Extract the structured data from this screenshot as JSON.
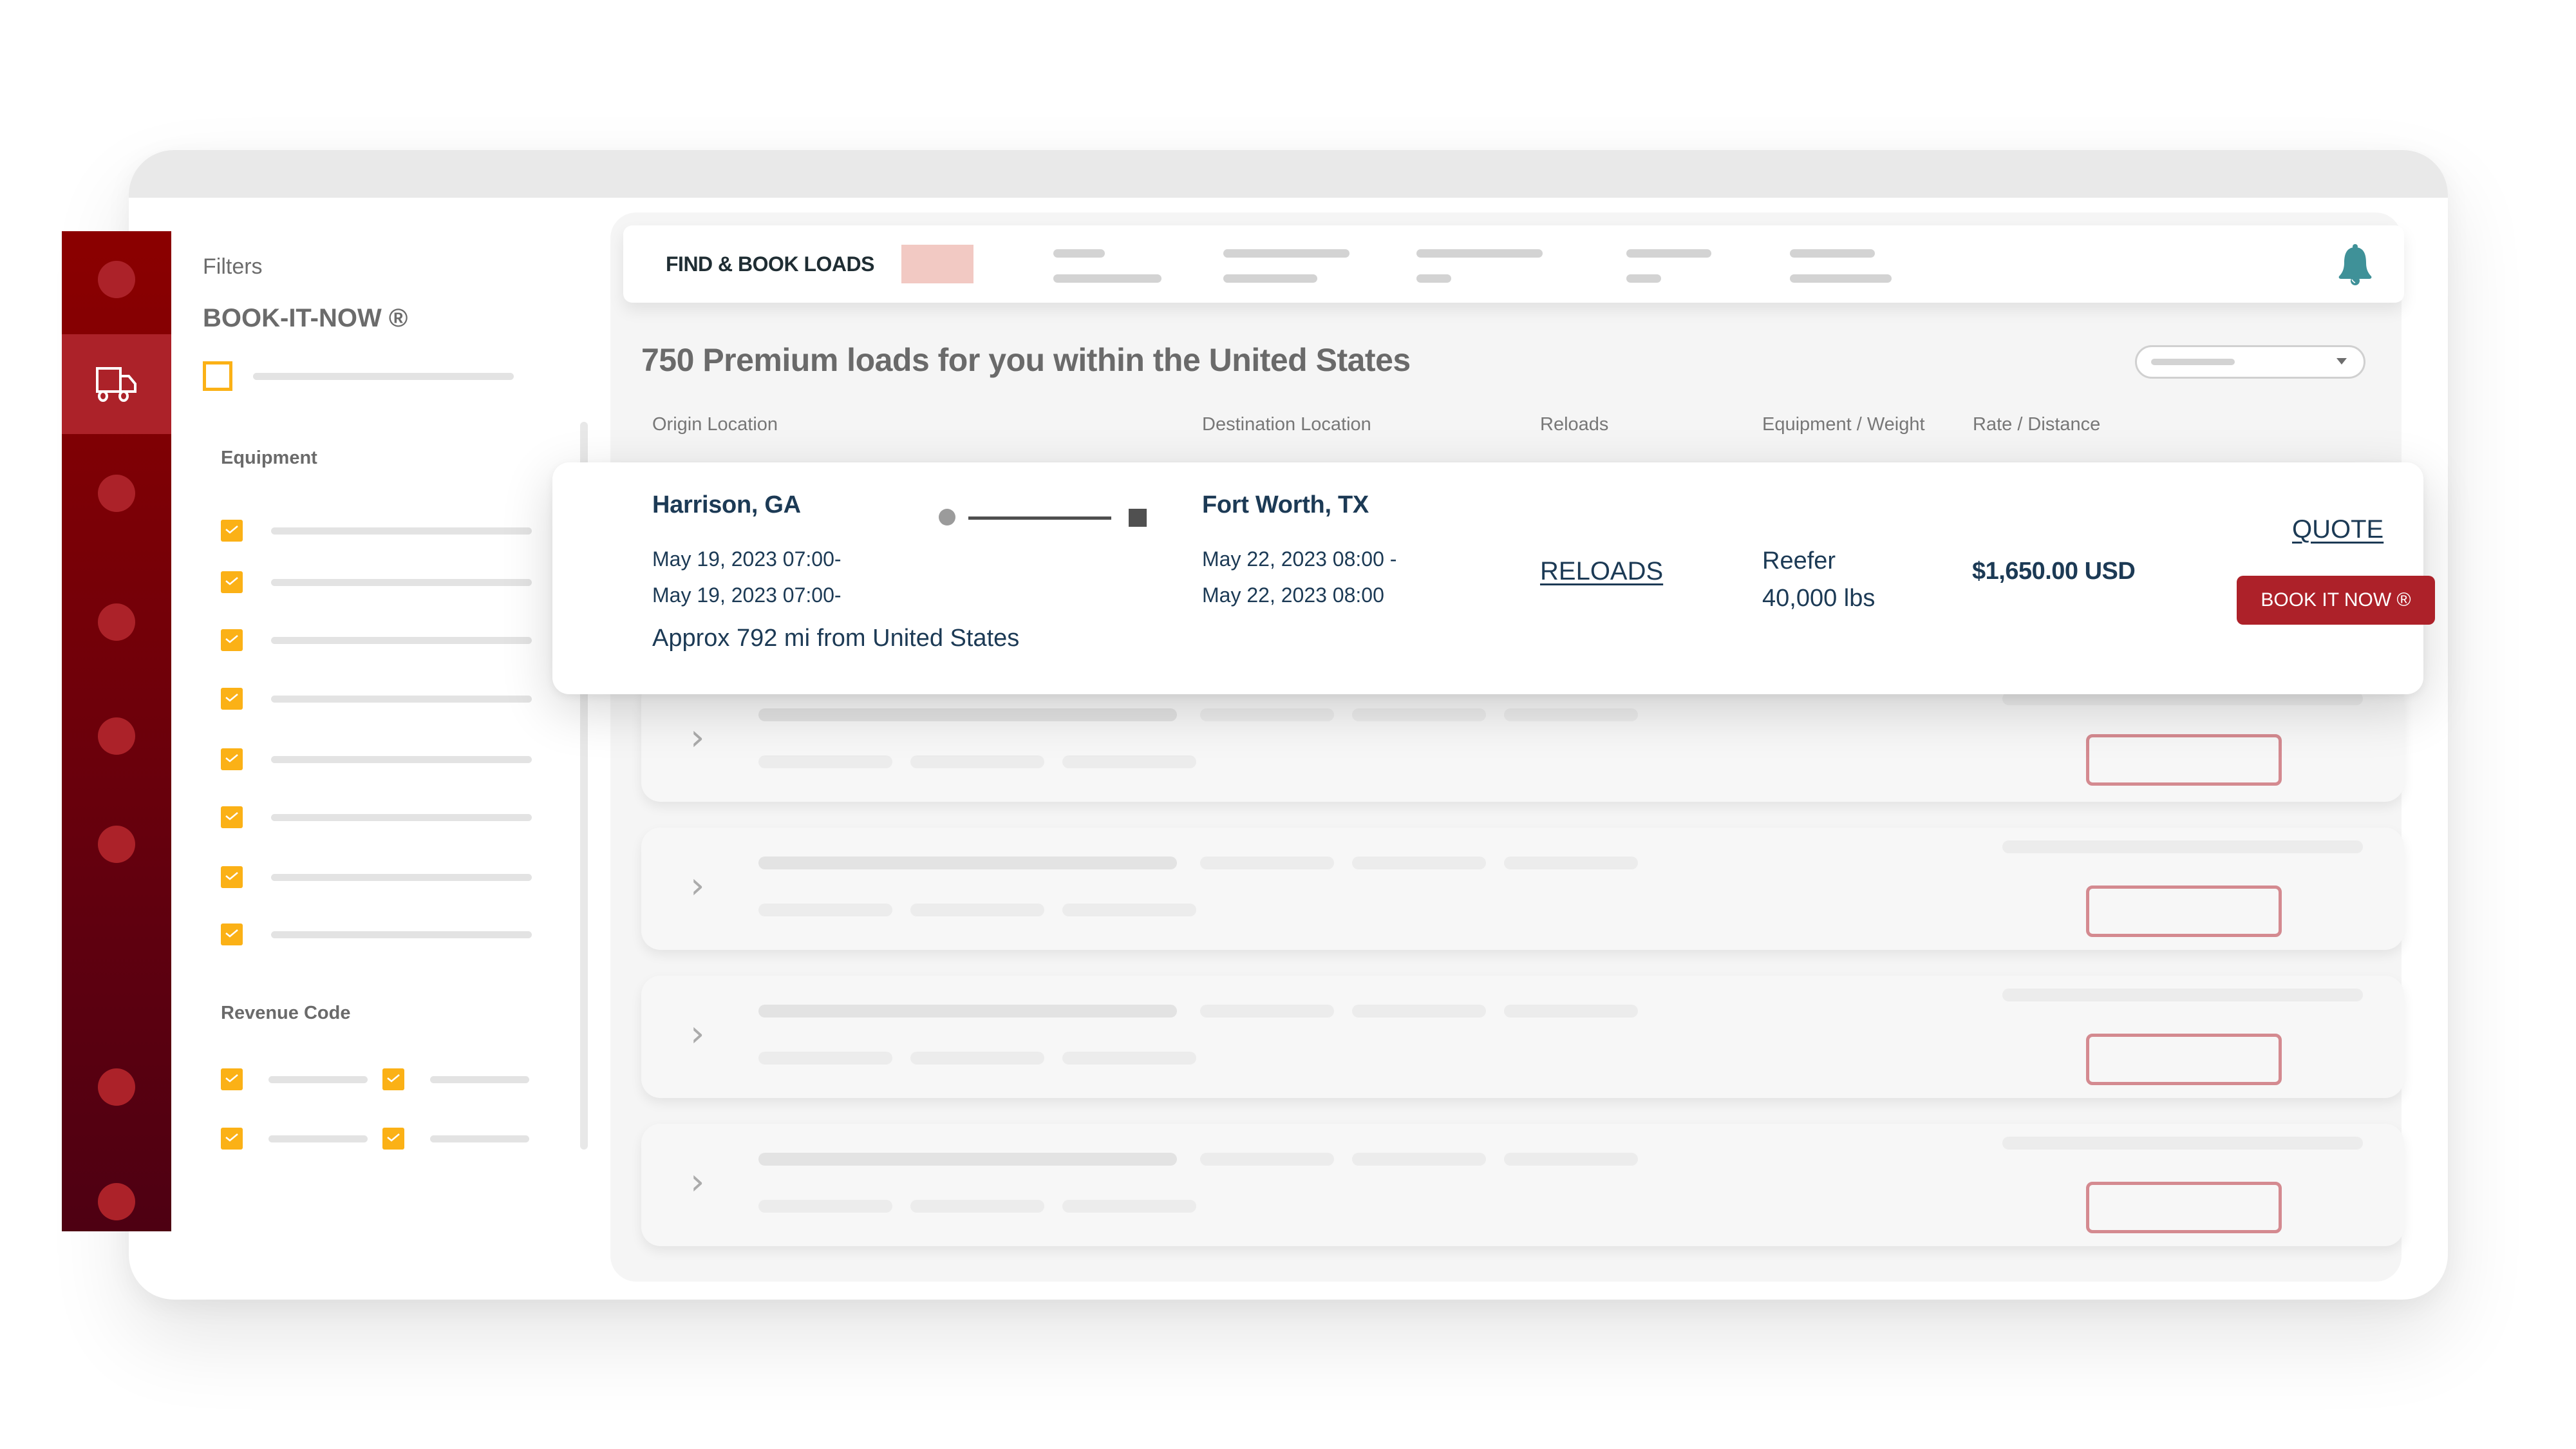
{
  "sidebar": {
    "items": [
      {
        "icon": "nav-dot-icon"
      },
      {
        "icon": "truck-icon",
        "active": true
      },
      {
        "icon": "nav-dot-icon"
      },
      {
        "icon": "nav-dot-icon"
      },
      {
        "icon": "nav-dot-icon"
      },
      {
        "icon": "nav-dot-icon"
      },
      {
        "icon": "nav-dot-icon"
      },
      {
        "icon": "nav-dot-icon"
      }
    ]
  },
  "filters": {
    "title": "Filters",
    "book_it_now_label": "BOOK-IT-NOW ®",
    "book_it_now_checked": false,
    "equipment_label": "Equipment",
    "equipment_options_checked": [
      true,
      true,
      true,
      true,
      true,
      true,
      true,
      true
    ],
    "revenue_code_label": "Revenue Code",
    "revenue_code_options_checked": [
      true,
      true,
      true,
      true
    ]
  },
  "topbar": {
    "title": "FIND & BOOK LOADS",
    "notification_icon": "bell-icon"
  },
  "results": {
    "heading": "750 Premium loads for you within the United States",
    "columns": [
      "Origin Location",
      "Destination Location",
      "Reloads",
      "Equipment / Weight",
      "Rate / Distance"
    ]
  },
  "featured_load": {
    "origin_city": "Harrison, GA",
    "origin_date_1": "May 19, 2023 07:00-",
    "origin_date_2": "May 19, 2023 07:00-",
    "approx_distance": "Approx 792 mi from United States",
    "destination_city": "Fort Worth, TX",
    "destination_date_1": "May 22, 2023 08:00 -",
    "destination_date_2": "May 22, 2023 08:00",
    "reloads_link": "RELOADS",
    "equipment": "Reefer",
    "weight": "40,000 lbs",
    "rate": "$1,650.00 USD",
    "quote_link": "QUOTE",
    "book_button": "BOOK IT NOW ®"
  },
  "colors": {
    "brand_red": "#ad2129",
    "rail_dark_red": "#8b0000",
    "checkbox_yellow": "#fbb116",
    "bell_teal": "#3f9198",
    "text_navy": "#1c3a55"
  }
}
